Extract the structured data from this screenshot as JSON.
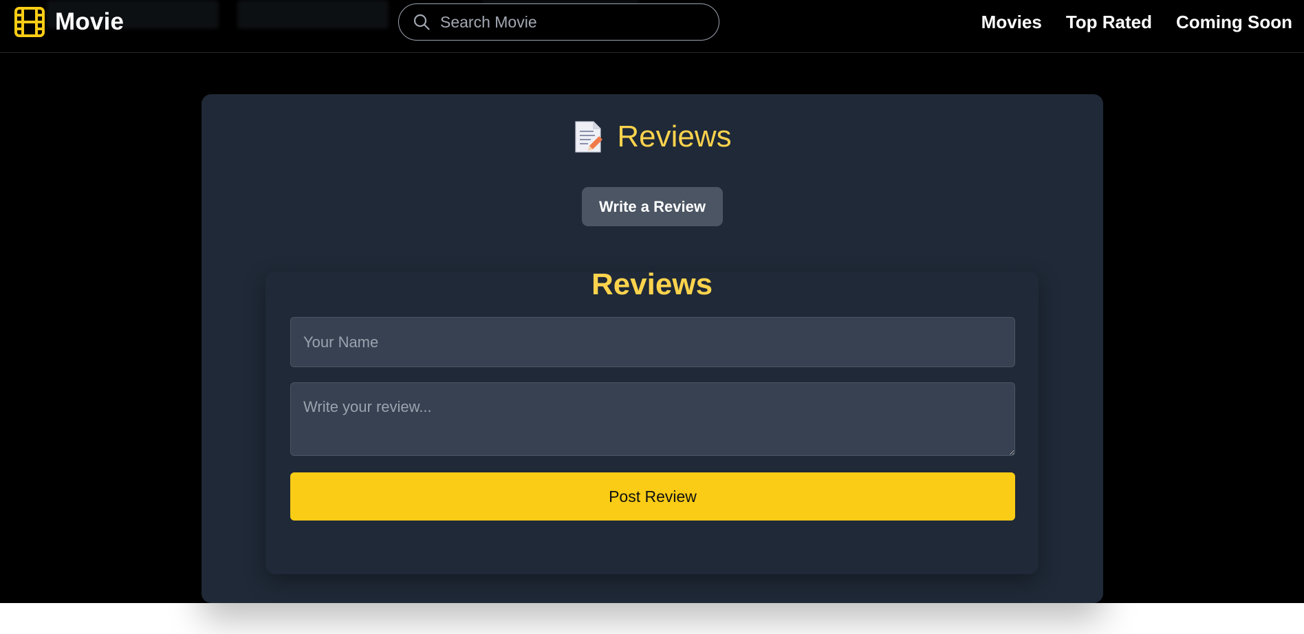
{
  "header": {
    "brand": "Movie",
    "brand_icon": "film-icon",
    "search": {
      "icon": "search-icon",
      "placeholder": "Search Movie",
      "value": ""
    },
    "nav": [
      "Movies",
      "Top Rated",
      "Coming Soon"
    ]
  },
  "reviews_section": {
    "icon": "memo-icon",
    "title": "Reviews",
    "write_button": "Write a Review",
    "form": {
      "title": "Reviews",
      "name_placeholder": "Your Name",
      "name_value": "",
      "review_placeholder": "Write your review...",
      "review_value": "",
      "submit_label": "Post Review"
    }
  },
  "colors": {
    "accent": "#facc15",
    "title": "#fcd34d",
    "card": "#1f2937",
    "input": "#374151",
    "secondary_button": "#4b5563"
  }
}
